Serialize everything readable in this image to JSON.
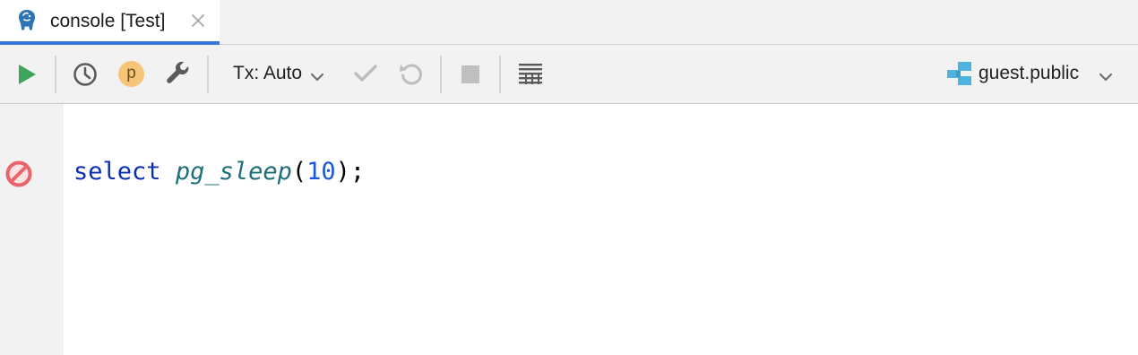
{
  "tab": {
    "title": "console [Test]",
    "icon": "postgresql-elephant-icon"
  },
  "toolbar": {
    "p_badge": "p",
    "tx_mode": "Tx: Auto",
    "schema": "guest.public"
  },
  "editor": {
    "code": {
      "keyword": "select",
      "function": "pg_sleep",
      "open_paren": "(",
      "argument": "10",
      "close": ");"
    }
  },
  "colors": {
    "accent": "#3479d6",
    "run": "#3fa45b",
    "keyword": "#0b2fb3",
    "function": "#1f6f7a",
    "number": "#1a56e0",
    "error": "#e9656b"
  }
}
